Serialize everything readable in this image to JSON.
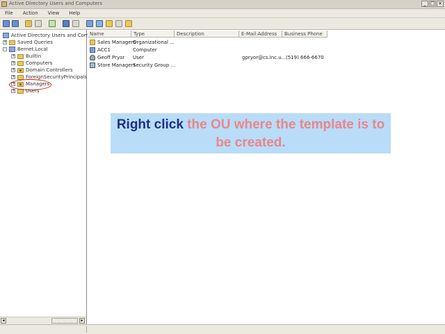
{
  "window": {
    "title": "Active Directory Users and Computers",
    "buttons": [
      "_",
      "□",
      "×"
    ]
  },
  "menu": [
    "File",
    "Action",
    "View",
    "Help"
  ],
  "tree": {
    "root_label": "Active Directory Users and Compu",
    "saved_queries": "Saved Queries",
    "domain": "Bernet.Local",
    "children": [
      "Builtin",
      "Computers",
      "Domain Controllers",
      "ForeignSecurityPrincipals",
      "Managers",
      "Users"
    ],
    "highlighted": "Managers"
  },
  "list": {
    "columns": [
      "Name",
      "Type",
      "Description",
      "E-Mail Address",
      "Business Phone"
    ],
    "rows": [
      {
        "name": "Sales Managers",
        "type": "Organizational ...",
        "description": "",
        "email": "",
        "phone": ""
      },
      {
        "name": "ACC1",
        "type": "Computer",
        "description": "",
        "email": "",
        "phone": ""
      },
      {
        "name": "Geoff Pryor",
        "type": "User",
        "description": "",
        "email": "gpryor@cs.inc.u...",
        "phone": "(519) 666-6670"
      },
      {
        "name": "Store Managers",
        "type": "Security Group ...",
        "description": "",
        "email": "",
        "phone": ""
      }
    ]
  },
  "callout": {
    "part1": "Right click",
    "part2": "the OU where the template is to be created."
  },
  "colors": {
    "callout_bg": "#b9dcf8",
    "callout_dark": "#1c2f84",
    "callout_pink": "#e9868a",
    "highlight_circle": "#dd1111"
  }
}
